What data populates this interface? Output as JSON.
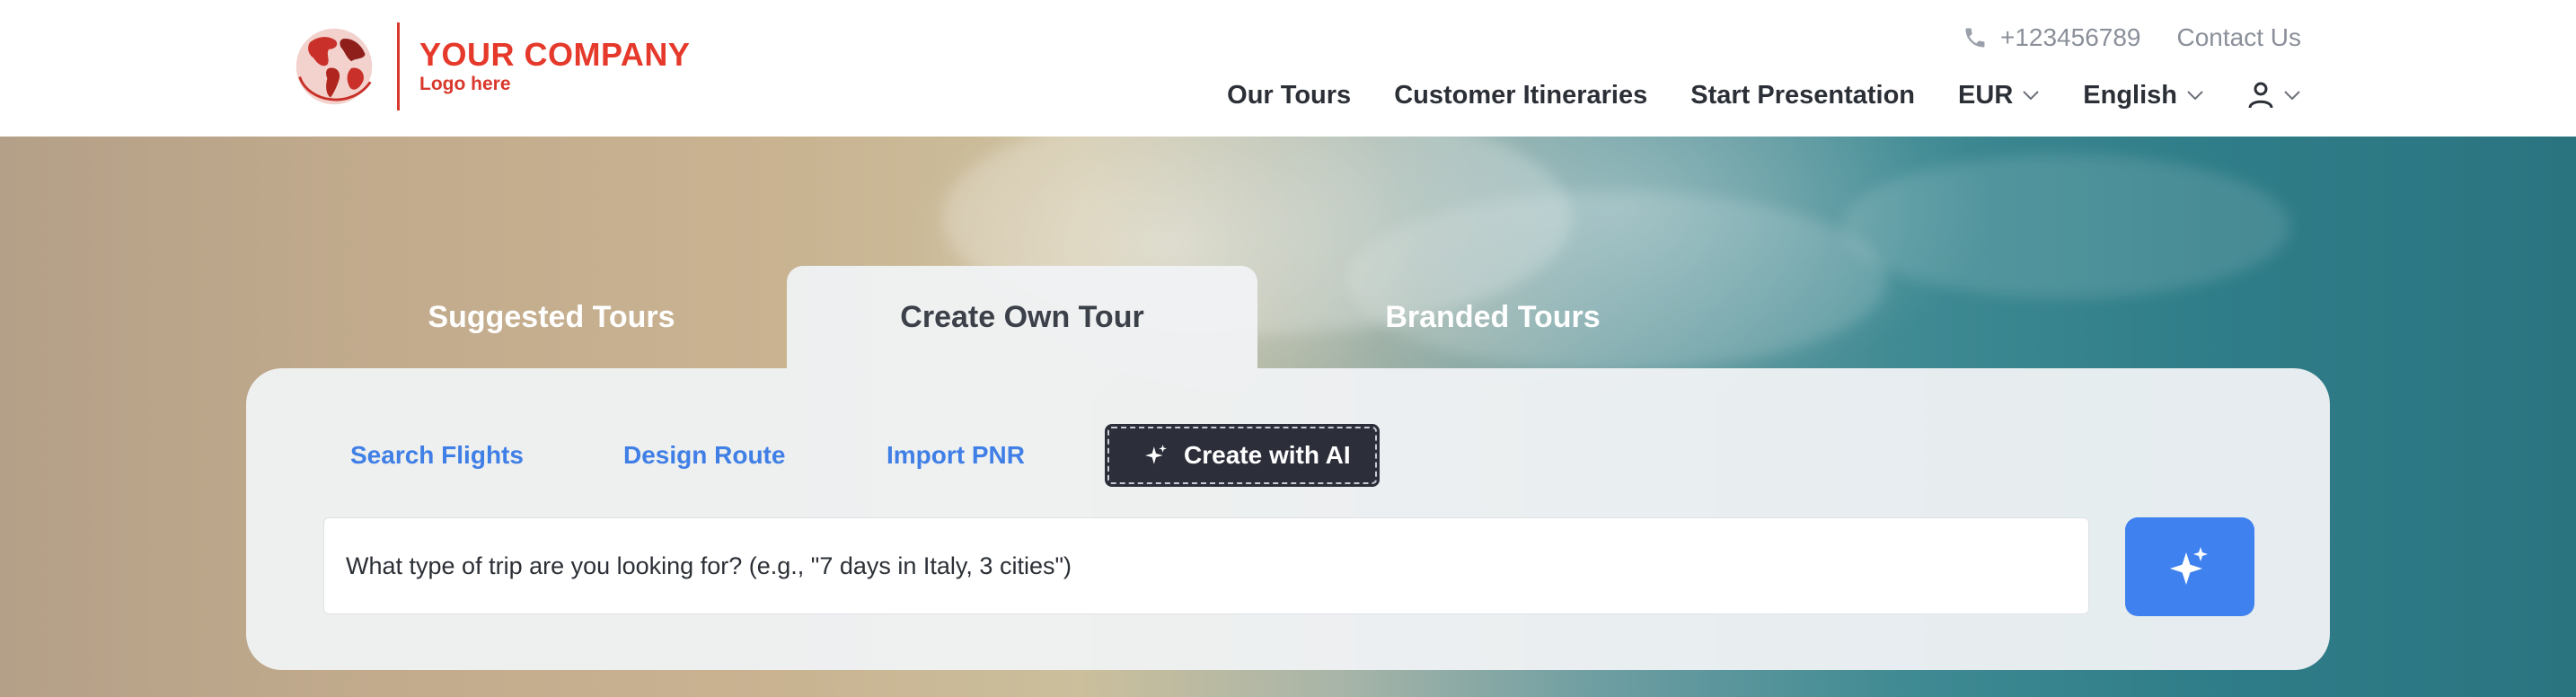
{
  "header": {
    "logo": {
      "name": "YOUR COMPANY",
      "sub": "Logo here"
    },
    "phone": "+123456789",
    "contact": "Contact Us",
    "nav": {
      "our_tours": "Our Tours",
      "customer_itineraries": "Customer Itineraries",
      "start_presentation": "Start Presentation",
      "currency": "EUR",
      "language": "English"
    }
  },
  "tabs": {
    "suggested": "Suggested Tours",
    "create_own": "Create Own Tour",
    "branded": "Branded Tours",
    "active": "create_own"
  },
  "subtabs": {
    "search_flights": "Search Flights",
    "design_route": "Design Route",
    "import_pnr": "Import PNR",
    "create_ai": "Create with AI",
    "active": "create_ai"
  },
  "search": {
    "text": "What type of trip are you looking for? (e.g., \"7 days in Italy, 3 cities\")"
  },
  "colors": {
    "brand_red": "#e5392b",
    "link_blue": "#3f7fe6",
    "primary_button": "#3f82ef",
    "dark_tab": "#2c2f3a"
  },
  "icons": [
    "globe-logo-icon",
    "phone-icon",
    "chevron-down-icon",
    "user-icon",
    "sparkle-icon"
  ]
}
